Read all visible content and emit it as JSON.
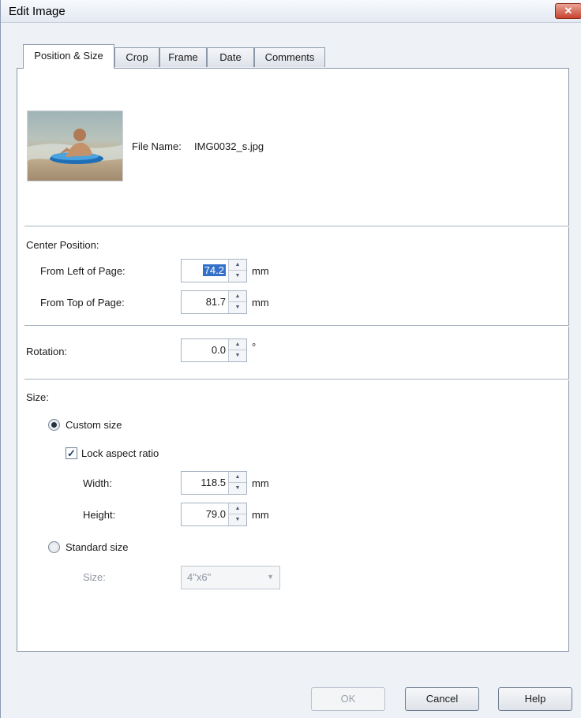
{
  "window": {
    "title": "Edit Image",
    "close_glyph": "✕"
  },
  "tabs": [
    {
      "label": "Position & Size",
      "active": true
    },
    {
      "label": "Crop",
      "active": false
    },
    {
      "label": "Frame",
      "active": false
    },
    {
      "label": "Date",
      "active": false
    },
    {
      "label": "Comments",
      "active": false
    }
  ],
  "file": {
    "label": "File Name:",
    "name": "IMG0032_s.jpg"
  },
  "center_position": {
    "heading": "Center Position:",
    "left_label": "From Left of Page:",
    "left_value": "74.2",
    "left_unit": "mm",
    "top_label": "From Top of Page:",
    "top_value": "81.7",
    "top_unit": "mm"
  },
  "rotation": {
    "label": "Rotation:",
    "value": "0.0",
    "unit": "°"
  },
  "size": {
    "heading": "Size:",
    "custom_label": "Custom size",
    "custom_selected": true,
    "lock_label": "Lock aspect ratio",
    "lock_checked": true,
    "width_label": "Width:",
    "width_value": "118.5",
    "width_unit": "mm",
    "height_label": "Height:",
    "height_value": "79.0",
    "height_unit": "mm",
    "standard_label": "Standard size",
    "standard_selected": false,
    "size_label": "Size:",
    "size_value": "4\"x6\""
  },
  "buttons": {
    "ok": "OK",
    "cancel": "Cancel",
    "help": "Help"
  },
  "icons": {
    "checkmark": "✓",
    "spin_up": "▲",
    "spin_down": "▼",
    "dropdown": "▼"
  },
  "colors": {
    "selection": "#3371c9",
    "close_button": "#c8442f"
  }
}
